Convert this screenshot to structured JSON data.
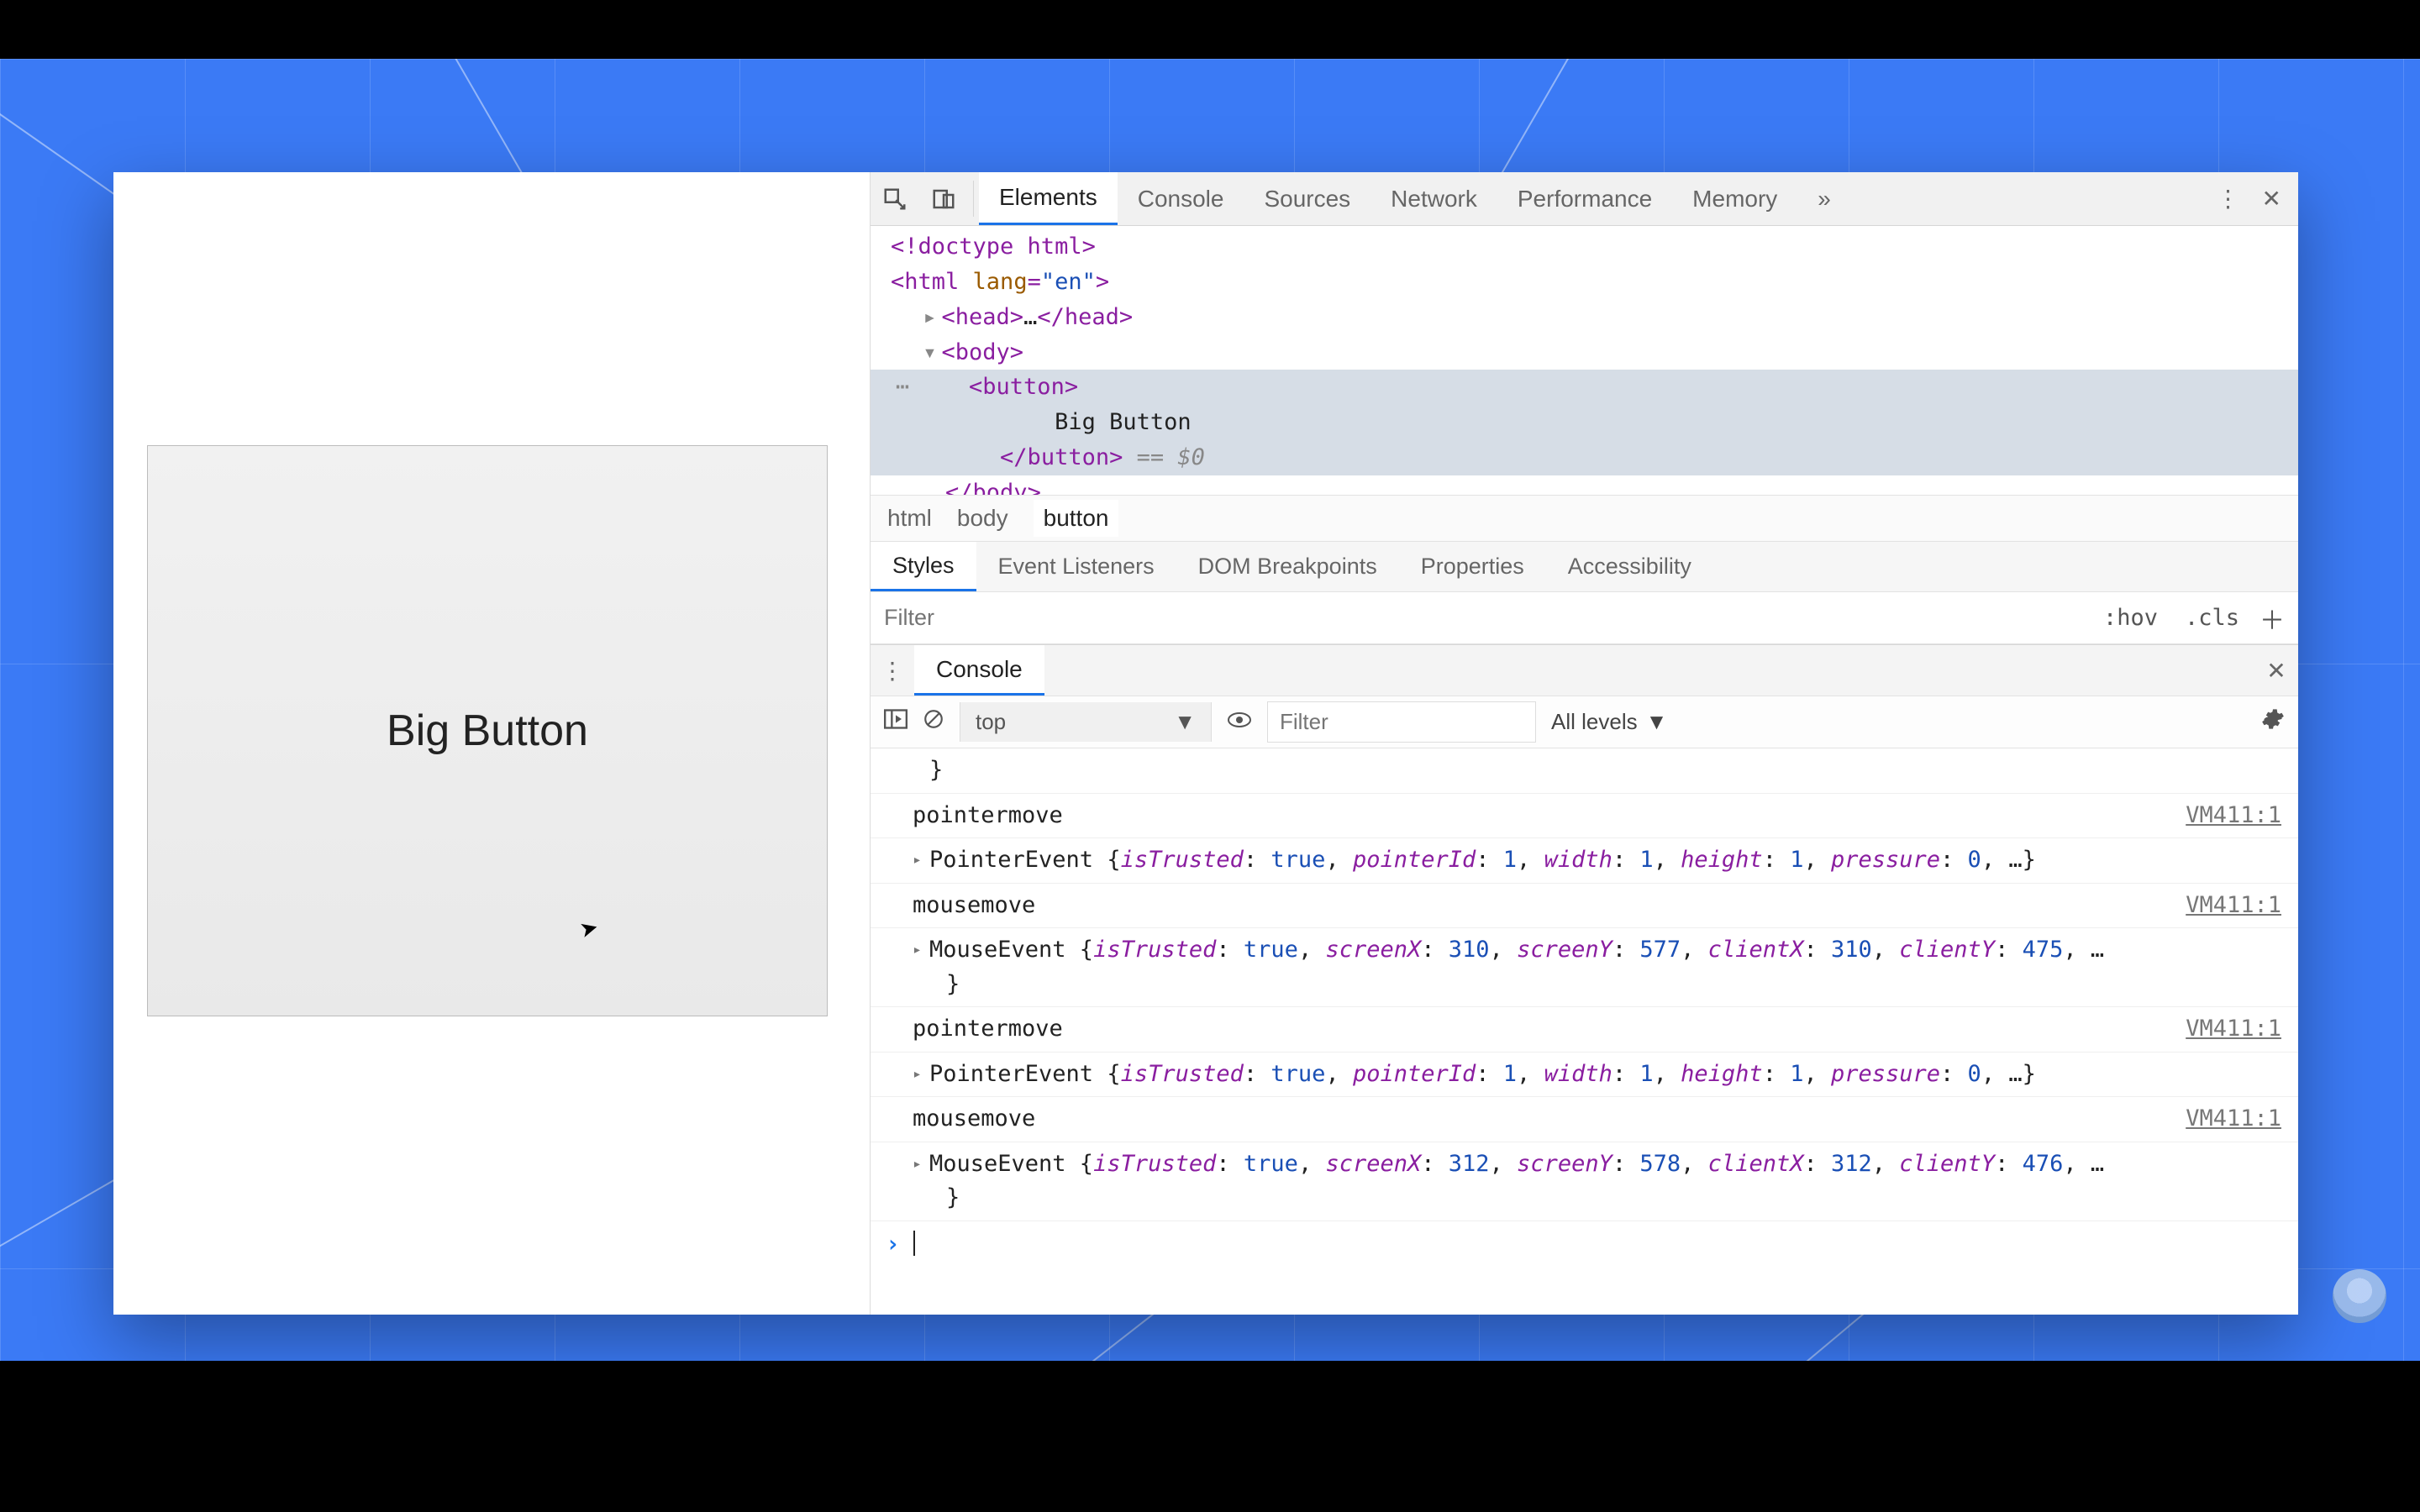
{
  "viewport": {
    "button_label": "Big Button"
  },
  "devtools": {
    "tabs": [
      "Elements",
      "Console",
      "Sources",
      "Network",
      "Performance",
      "Memory"
    ],
    "active_tab": "Elements",
    "overflow_glyph": "»"
  },
  "dom": {
    "doctype": "<!doctype html>",
    "html_open": "<html lang=\"en\">",
    "head_collapsed": "<head>…</head>",
    "body_open": "<body>",
    "button_open": "<button>",
    "button_text": "Big Button",
    "button_close": "</button>",
    "selected_suffix": " == $0",
    "body_close": "</body>",
    "ellipsis": "…"
  },
  "breadcrumbs": [
    "html",
    "body",
    "button"
  ],
  "subpanel": {
    "tabs": [
      "Styles",
      "Event Listeners",
      "DOM Breakpoints",
      "Properties",
      "Accessibility"
    ],
    "active": "Styles",
    "filter_placeholder": "Filter",
    "hov": ":hov",
    "cls": ".cls"
  },
  "console_drawer": {
    "title": "Console",
    "context": "top",
    "filter_placeholder": "Filter",
    "levels_label": "All levels"
  },
  "console": {
    "brace_close": "}",
    "entries": [
      {
        "name": "pointermove",
        "src": "VM411:1",
        "obj": "PointerEvent {isTrusted: true, pointerId: 1, width: 1, height: 1, pressure: 0, …}"
      },
      {
        "name": "mousemove",
        "src": "VM411:1",
        "obj": "MouseEvent {isTrusted: true, screenX: 310, screenY: 577, clientX: 310, clientY: 475, …}",
        "wrap": true
      },
      {
        "name": "pointermove",
        "src": "VM411:1",
        "obj": "PointerEvent {isTrusted: true, pointerId: 1, width: 1, height: 1, pressure: 0, …}"
      },
      {
        "name": "mousemove",
        "src": "VM411:1",
        "obj": "MouseEvent {isTrusted: true, screenX: 312, screenY: 578, clientX: 312, clientY: 476, …}",
        "wrap": true
      }
    ]
  }
}
